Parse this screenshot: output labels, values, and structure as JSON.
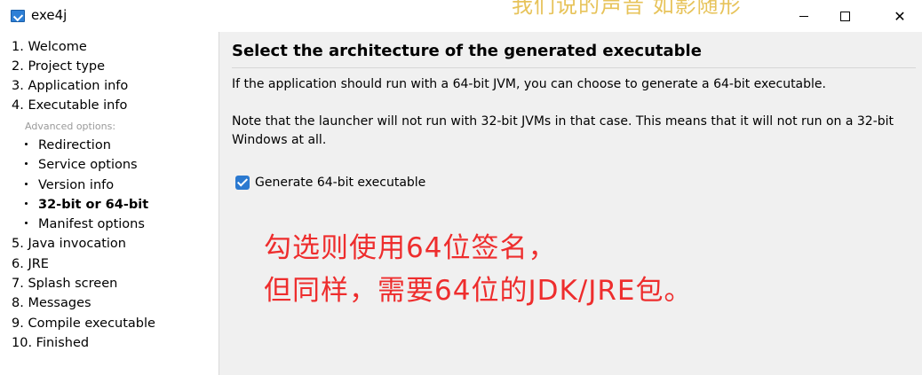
{
  "window": {
    "title": "exe4j",
    "watermark": "我们说的声音 如影随形",
    "controls": [
      "minimize",
      "maximize",
      "close"
    ]
  },
  "sidebar": {
    "steps_top": [
      "1. Welcome",
      "2. Project type",
      "3. Application info",
      "4. Executable info"
    ],
    "advanced_label": "Advanced options:",
    "sub_items": [
      {
        "label": "Redirection",
        "active": false
      },
      {
        "label": "Service options",
        "active": false
      },
      {
        "label": "Version info",
        "active": false
      },
      {
        "label": "32-bit or 64-bit",
        "active": true
      },
      {
        "label": "Manifest options",
        "active": false
      }
    ],
    "steps_bottom": [
      "5. Java invocation",
      "6. JRE",
      "7. Splash screen",
      "8. Messages",
      "9. Compile executable",
      "10. Finished"
    ]
  },
  "main": {
    "heading": "Select the architecture of the generated executable",
    "paragraph1": "If the application should run with a 64-bit JVM, you can choose to generate a 64-bit executable.",
    "paragraph2_line1": "Note that the launcher will not run with 32-bit JVMs in that case. This means that it will not run on a 32-bit",
    "paragraph2_line2": "Windows at all.",
    "checkbox": {
      "label": "Generate 64-bit executable",
      "checked": true
    }
  },
  "annotation": {
    "line1": "勾选则使用64位签名，",
    "line2": "但同样，需要64位的JDK/JRE包。",
    "color": "#ee2d2d"
  }
}
